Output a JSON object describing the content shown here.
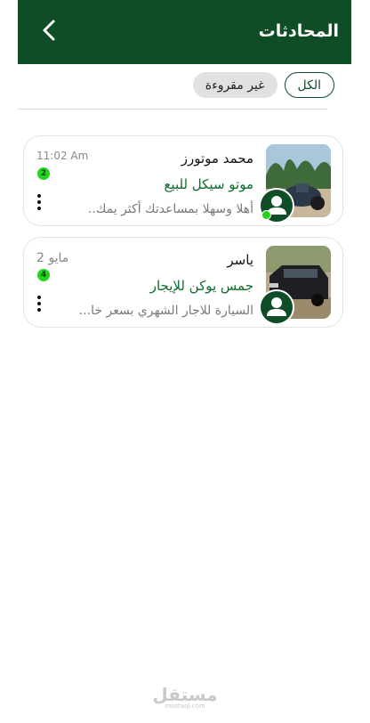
{
  "header": {
    "title": "المحادثات",
    "back_icon": "chevron-left-icon"
  },
  "filters": {
    "all": "الكل",
    "unread": "غير مقروءة"
  },
  "conversations": [
    {
      "name": "محمد موتورز",
      "subject": "موتو سيكل للبيع",
      "preview": "أهلا وسهلا بمساعدتك أكثر يمك..",
      "time": "11:02 Am",
      "unread": "2",
      "online": true
    },
    {
      "name": "ياسر",
      "subject": "جمس يوكن للإيجار",
      "preview": "السيارة للاجار الشهري بسعر خا...",
      "time": "2 مايو",
      "unread": "4",
      "online": false
    }
  ],
  "watermark": {
    "main": "مستقل",
    "sub": "mostaql.com"
  },
  "colors": {
    "primary": "#0e4d26",
    "accent_green": "#22d41c",
    "subject_green": "#0e6b2b"
  }
}
